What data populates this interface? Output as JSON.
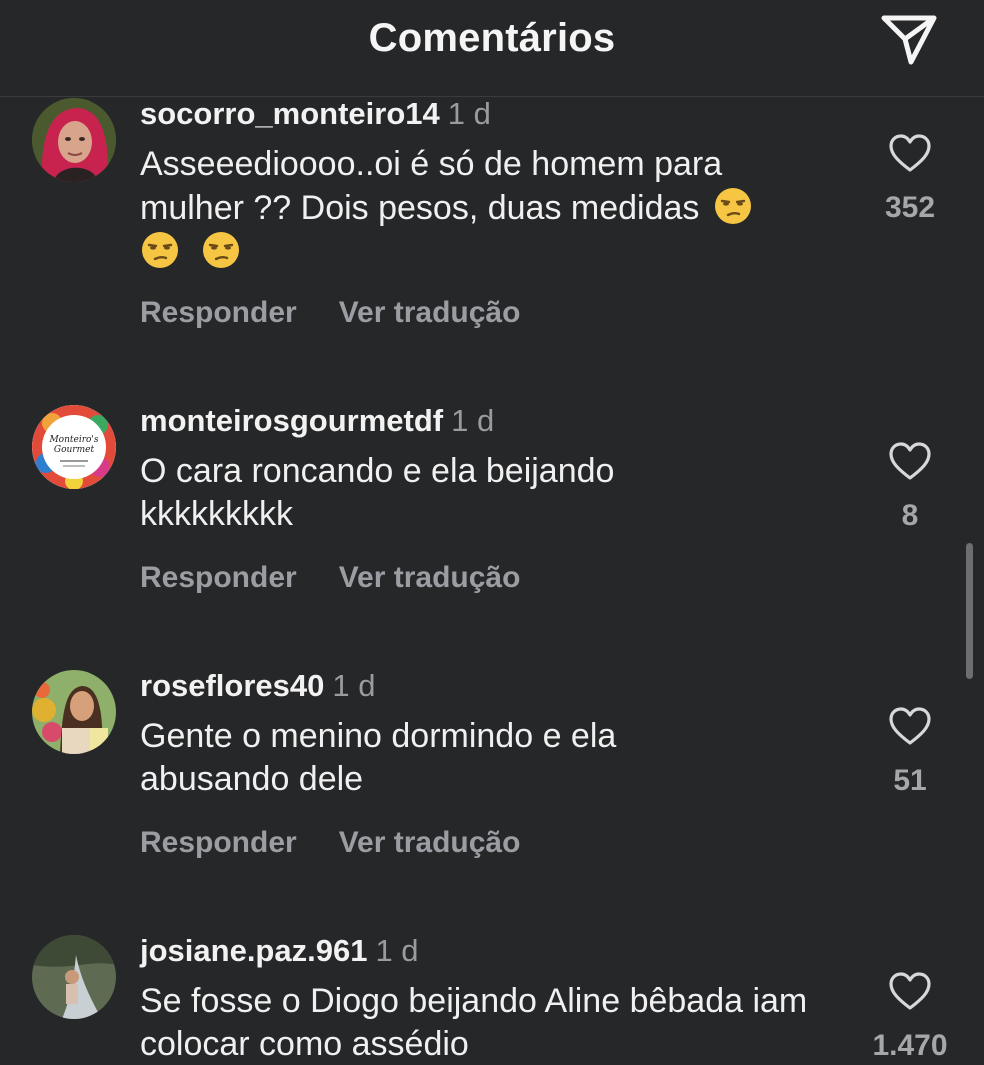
{
  "header": {
    "title": "Comentários",
    "send_icon": "paper-plane-icon"
  },
  "comments": [
    {
      "username": "socorro_monteiro14",
      "time": "1 d",
      "text_line1": "Asseeedioooo..oi é só de homem para",
      "text_line2": "mulher ?? Dois pesos, duas medidas",
      "emoji": "unamused-face",
      "likes": "352",
      "reply_label": "Responder",
      "translate_label": "Ver tradução"
    },
    {
      "username": "monteirosgourmetdf",
      "time": "1 d",
      "text": "O cara roncando e ela beijando kkkkkkkkk",
      "avatar_text_line1": "Monteiro's",
      "avatar_text_line2": "Gourmet",
      "likes": "8",
      "reply_label": "Responder",
      "translate_label": "Ver tradução"
    },
    {
      "username": "roseflores40",
      "time": "1 d",
      "text": "Gente o menino dormindo e ela abusando dele",
      "likes": "51",
      "reply_label": "Responder",
      "translate_label": "Ver tradução"
    },
    {
      "username": "josiane.paz.961",
      "time": "1 d",
      "text": "Se fosse o Diogo beijando Aline bêbada iam colocar como assédio",
      "likes": "1.470"
    }
  ],
  "colors": {
    "background": "#262729",
    "text_primary": "#f2f2f2",
    "text_secondary": "#9c9da2"
  }
}
